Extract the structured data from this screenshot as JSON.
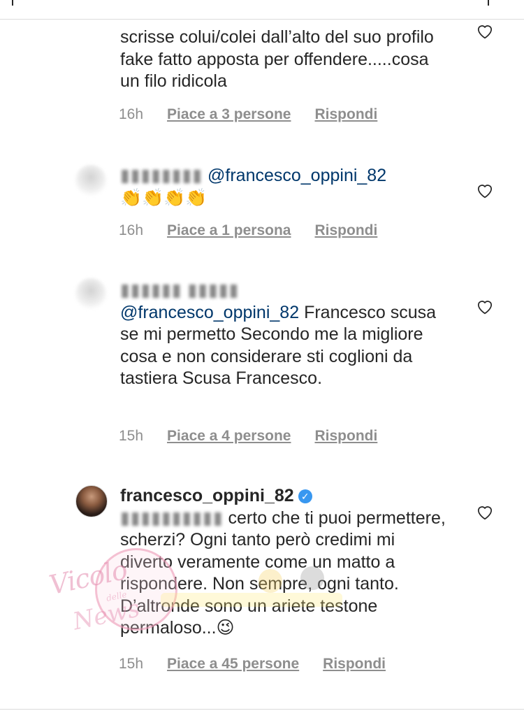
{
  "comments": [
    {
      "username": "",
      "text": "scrisse colui/colei dall’alto del suo profilo fake fatto apposta per offendere.....cosa un filo ridicola",
      "time": "16h",
      "likes": "Piace a 3 persone",
      "reply": "Rispondi"
    },
    {
      "username": "",
      "mention": "@francesco_oppini_82",
      "text": "👏👏👏👏",
      "time": "16h",
      "likes": "Piace a 1 persona",
      "reply": "Rispondi"
    },
    {
      "username": "",
      "mention": "@francesco_oppini_82",
      "text": "Francesco scusa se mi permetto Secondo me la migliore cosa e non considerare sti coglioni da tastiera Scusa Francesco.",
      "time": "15h",
      "likes": "Piace a 4 persone",
      "reply": "Rispondi"
    },
    {
      "username": "francesco_oppini_82",
      "verified": true,
      "text": "certo che ti puoi permettere, scherzi? Ogni tanto però credimi mi diverto veramente come un matto a rispondere. Non sempre, ogni tanto. D’altronde sono un ariete testone permaloso...😉",
      "time": "15h",
      "likes": "Piace a 45 persone",
      "reply": "Rispondi"
    }
  ],
  "icons": {
    "like": "heart-outline-icon",
    "verified": "verified-badge-icon"
  },
  "watermark": {
    "line1": "Vicolo",
    "line2": "delle",
    "line3": "News"
  },
  "colors": {
    "mention": "#00376b",
    "meta": "#8e8e8e",
    "text": "#262626",
    "verified": "#3897f0"
  }
}
